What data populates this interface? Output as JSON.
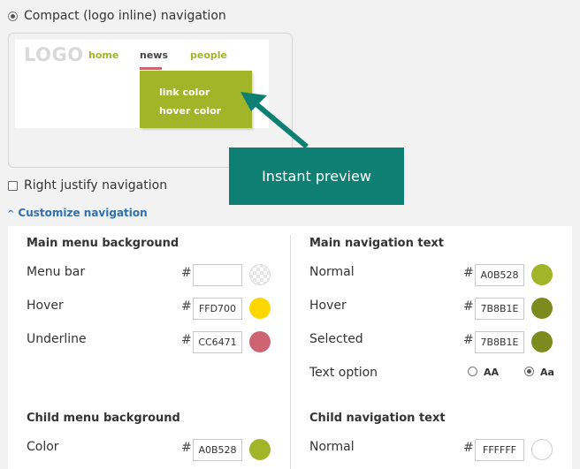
{
  "nav_option": {
    "label": "Compact (logo inline) navigation",
    "selected": true
  },
  "preview": {
    "logo": "LOGO",
    "links": [
      "home",
      "news",
      "people"
    ],
    "active_link": "news",
    "dropdown": [
      "link color",
      "hover color"
    ],
    "callout": "Instant preview"
  },
  "right_justify": {
    "label": "Right justify navigation",
    "checked": false
  },
  "customize": {
    "label": "Customize navigation",
    "expanded": true
  },
  "main_menu_background": {
    "title": "Main menu background",
    "rows": [
      {
        "label": "Menu bar",
        "hex": "",
        "color": ""
      },
      {
        "label": "Hover",
        "hex": "FFD700",
        "color": "#FFD700"
      },
      {
        "label": "Underline",
        "hex": "CC6471",
        "color": "#CC6471"
      }
    ]
  },
  "main_navigation_text": {
    "title": "Main navigation text",
    "rows": [
      {
        "label": "Normal",
        "hex": "A0B528",
        "color": "#A0B528"
      },
      {
        "label": "Hover",
        "hex": "7B8B1E",
        "color": "#7B8B1E"
      },
      {
        "label": "Selected",
        "hex": "7B8B1E",
        "color": "#7B8B1E"
      }
    ],
    "text_option": {
      "label": "Text option",
      "options": [
        "AA",
        "Aa"
      ],
      "selected": "Aa"
    }
  },
  "child_menu_background": {
    "title": "Child menu background",
    "rows": [
      {
        "label": "Color",
        "hex": "A0B528",
        "color": "#A0B528"
      }
    ]
  },
  "child_navigation_text": {
    "title": "Child navigation text",
    "rows": [
      {
        "label": "Normal",
        "hex": "FFFFFF",
        "color": "#FFFFFF"
      }
    ]
  },
  "hash_symbol": "#"
}
